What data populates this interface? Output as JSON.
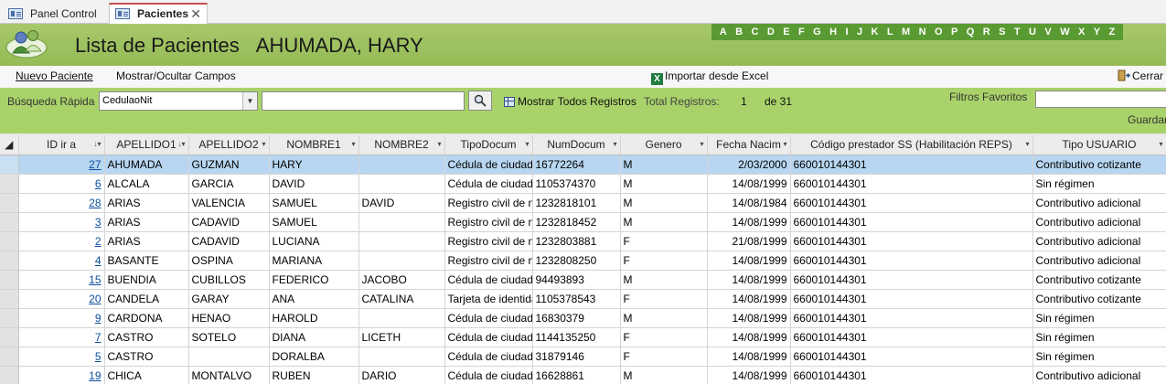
{
  "tabs": [
    {
      "label": "Panel Control",
      "active": false
    },
    {
      "label": "Pacientes",
      "active": true
    }
  ],
  "header": {
    "title": "Lista de Pacientes",
    "patient_name": "AHUMADA, HARY",
    "alphabet": [
      "A",
      "B",
      "C",
      "D",
      "E",
      "F",
      "G",
      "H",
      "I",
      "J",
      "K",
      "L",
      "M",
      "N",
      "O",
      "P",
      "Q",
      "R",
      "S",
      "T",
      "U",
      "V",
      "W",
      "X",
      "Y",
      "Z"
    ]
  },
  "commands": {
    "nuevo": "Nuevo Paciente",
    "mostrar": "Mostrar/Ocultar Campos",
    "importar": "Importar desde Excel",
    "cerrar": "Cerrar"
  },
  "search": {
    "label": "Búsqueda Rápida",
    "field_value": "CedulaoNit",
    "query": "",
    "show_all": "Mostrar Todos Registros",
    "total_label": "Total Registros:",
    "current": "1",
    "of_total": "de 31",
    "favorites_label": "Filtros Favoritos",
    "save_label": "Guardar"
  },
  "colors": {
    "header_green": "#95bb56",
    "search_green": "#a9d36a",
    "alpha_green": "#5a9a32",
    "selected_row": "#b8d6f1"
  },
  "table": {
    "columns": [
      "ID ir a",
      "APELLIDO1",
      "APELLIDO2",
      "NOMBRE1",
      "NOMBRE2",
      "TipoDocum",
      "NumDocum",
      "Genero",
      "Fecha Nacim",
      "Código prestador SS (Habilitación REPS)",
      "Tipo USUARIO"
    ],
    "rows": [
      [
        "27",
        "AHUMADA",
        "GUZMAN",
        "HARY",
        "",
        "Cédula de ciudadanía",
        "16772264",
        "M",
        "2/03/2000",
        "660010144301",
        "Contributivo cotizante"
      ],
      [
        "6",
        "ALCALA",
        "GARCIA",
        "DAVID",
        "",
        "Cédula de ciudadanía",
        "1105374370",
        "M",
        "14/08/1999",
        "660010144301",
        "Sin régimen"
      ],
      [
        "28",
        "ARIAS",
        "VALENCIA",
        "SAMUEL",
        "DAVID",
        "Registro civil de nacimiento",
        "1232818101",
        "M",
        "14/08/1984",
        "660010144301",
        "Contributivo adicional"
      ],
      [
        "3",
        "ARIAS",
        "CADAVID",
        "SAMUEL",
        "",
        "Registro civil de nacimiento",
        "1232818452",
        "M",
        "14/08/1999",
        "660010144301",
        "Contributivo adicional"
      ],
      [
        "2",
        "ARIAS",
        "CADAVID",
        "LUCIANA",
        "",
        "Registro civil de nacimiento",
        "1232803881",
        "F",
        "21/08/1999",
        "660010144301",
        "Contributivo adicional"
      ],
      [
        "4",
        "BASANTE",
        "OSPINA",
        "MARIANA",
        "",
        "Registro civil de nacimiento",
        "1232808250",
        "F",
        "14/08/1999",
        "660010144301",
        "Contributivo adicional"
      ],
      [
        "15",
        "BUENDIA",
        "CUBILLOS",
        "FEDERICO",
        "JACOBO",
        "Cédula de ciudadanía",
        "94493893",
        "M",
        "14/08/1999",
        "660010144301",
        "Contributivo cotizante"
      ],
      [
        "20",
        "CANDELA",
        "GARAY",
        "ANA",
        "CATALINA",
        "Tarjeta de identidad",
        "1105378543",
        "F",
        "14/08/1999",
        "660010144301",
        "Contributivo cotizante"
      ],
      [
        "9",
        "CARDONA",
        "HENAO",
        "HAROLD",
        "",
        "Cédula de ciudadanía",
        "16830379",
        "M",
        "14/08/1999",
        "660010144301",
        "Sin régimen"
      ],
      [
        "7",
        "CASTRO",
        "SOTELO",
        "DIANA",
        "LICETH",
        "Cédula de ciudadanía",
        "1144135250",
        "F",
        "14/08/1999",
        "660010144301",
        "Sin régimen"
      ],
      [
        "5",
        "CASTRO",
        "",
        "DORALBA",
        "",
        "Cédula de ciudadanía",
        "31879146",
        "F",
        "14/08/1999",
        "660010144301",
        "Sin régimen"
      ],
      [
        "19",
        "CHICA",
        "MONTALVO",
        "RUBEN",
        "DARIO",
        "Cédula de ciudadanía",
        "16628861",
        "M",
        "14/08/1999",
        "660010144301",
        "Contributivo adicional"
      ]
    ]
  }
}
